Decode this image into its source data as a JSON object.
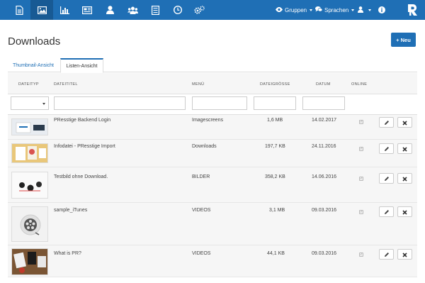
{
  "nav": {
    "icons": [
      "document-icon",
      "image-icon",
      "bar-chart-icon",
      "news-icon",
      "user-icon",
      "group-icon",
      "list-icon",
      "clock-icon",
      "settings-icon"
    ],
    "groups_label": "Gruppen",
    "languages_label": "Sprachen"
  },
  "page": {
    "title": "Downloads",
    "new_button": "+ Neu"
  },
  "tabs": [
    {
      "label": "Thumbnail-Ansicht",
      "active": false
    },
    {
      "label": "Listen-Ansicht",
      "active": true
    }
  ],
  "table": {
    "headers": [
      "DATEITYP",
      "DATEITITEL",
      "MENÜ",
      "DATEIGRÖSSE",
      "DATUM",
      "ONLINE"
    ],
    "rows": [
      {
        "title": "PResstige Backend Login",
        "menu": "Imagescreens",
        "size": "1,6 MB",
        "date": "14.02.2017",
        "online": "✓"
      },
      {
        "title": "Infodatei - PResstige Import",
        "menu": "Downloads",
        "size": "197,7 KB",
        "date": "24.11.2016",
        "online": "✓"
      },
      {
        "title": "Testbild ohne Download.",
        "menu": "BILDER",
        "size": "358,2 KB",
        "date": "14.06.2016",
        "online": "✓"
      },
      {
        "title": "sample_iTunes",
        "menu": "VIDEOS",
        "size": "3,1 MB",
        "date": "09.03.2016",
        "online": "✓"
      },
      {
        "title": "What is PR?",
        "menu": "VIDEOS",
        "size": "44,1 KB",
        "date": "09.03.2016",
        "online": "✓"
      }
    ]
  },
  "colors": {
    "primary": "#1f6fb5",
    "primary_dark": "#185a94"
  }
}
